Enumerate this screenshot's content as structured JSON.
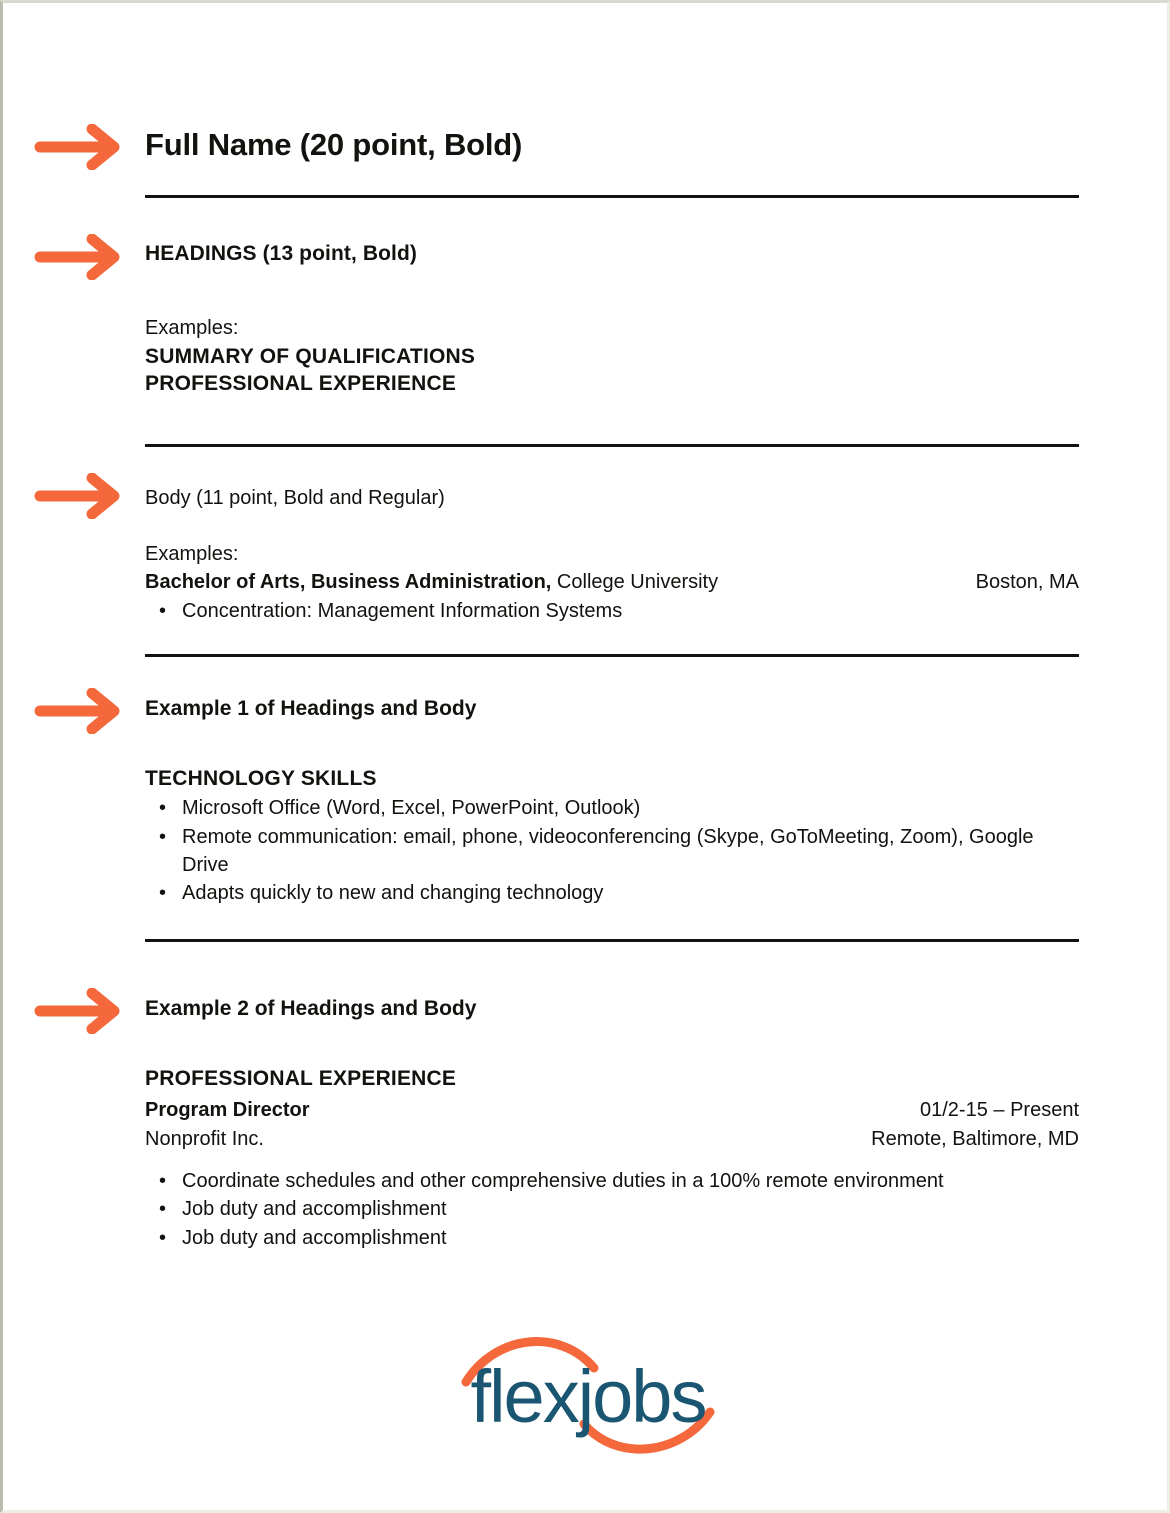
{
  "document": {
    "title": "Resume Formatting Guide",
    "accent_color": "#f4683c",
    "rule_color": "#14120f",
    "logo_text_color": "#1a5571"
  },
  "sections": [
    {
      "id": "name",
      "arrow": "right-arrow-icon",
      "callout": "Full Name (20 point, Bold)"
    },
    {
      "id": "headings",
      "arrow": "right-arrow-icon",
      "callout": "HEADINGS (13 point, Bold)",
      "examples_label": "Examples:",
      "examples": [
        "SUMMARY OF QUALIFICATIONS",
        "PROFESSIONAL EXPERIENCE"
      ]
    },
    {
      "id": "body",
      "arrow": "right-arrow-icon",
      "callout": "Body (11 point, Bold and Regular)",
      "examples_label": "Examples:",
      "degree_bold": "Bachelor of Arts, Business Administration,",
      "degree_school": " College University",
      "degree_location": "Boston, MA",
      "bullets": [
        "Concentration: Management Information Systems"
      ]
    },
    {
      "id": "example-1",
      "arrow": "right-arrow-icon",
      "callout": "Example 1 of Headings and Body",
      "heading": "TECHNOLOGY SKILLS",
      "bullets": [
        "Microsoft Office (Word, Excel, PowerPoint, Outlook)",
        "Remote communication: email, phone, videoconferencing (Skype, GoToMeeting, Zoom), Google Drive",
        "Adapts quickly to new and changing technology"
      ]
    },
    {
      "id": "example-2",
      "arrow": "right-arrow-icon",
      "callout": "Example 2 of Headings and Body",
      "heading": "PROFESSIONAL EXPERIENCE",
      "job_title": "Program Director",
      "job_dates": "01/2-15 – Present",
      "company": "Nonprofit Inc.",
      "job_location": "Remote, Baltimore, MD",
      "bullets": [
        "Coordinate schedules and other comprehensive duties in a 100% remote environment",
        "Job duty and accomplishment",
        "Job duty and accomplishment"
      ]
    }
  ],
  "footer": {
    "logo_name": "flexjobs",
    "logo_alt": "flexjobs-logo"
  }
}
